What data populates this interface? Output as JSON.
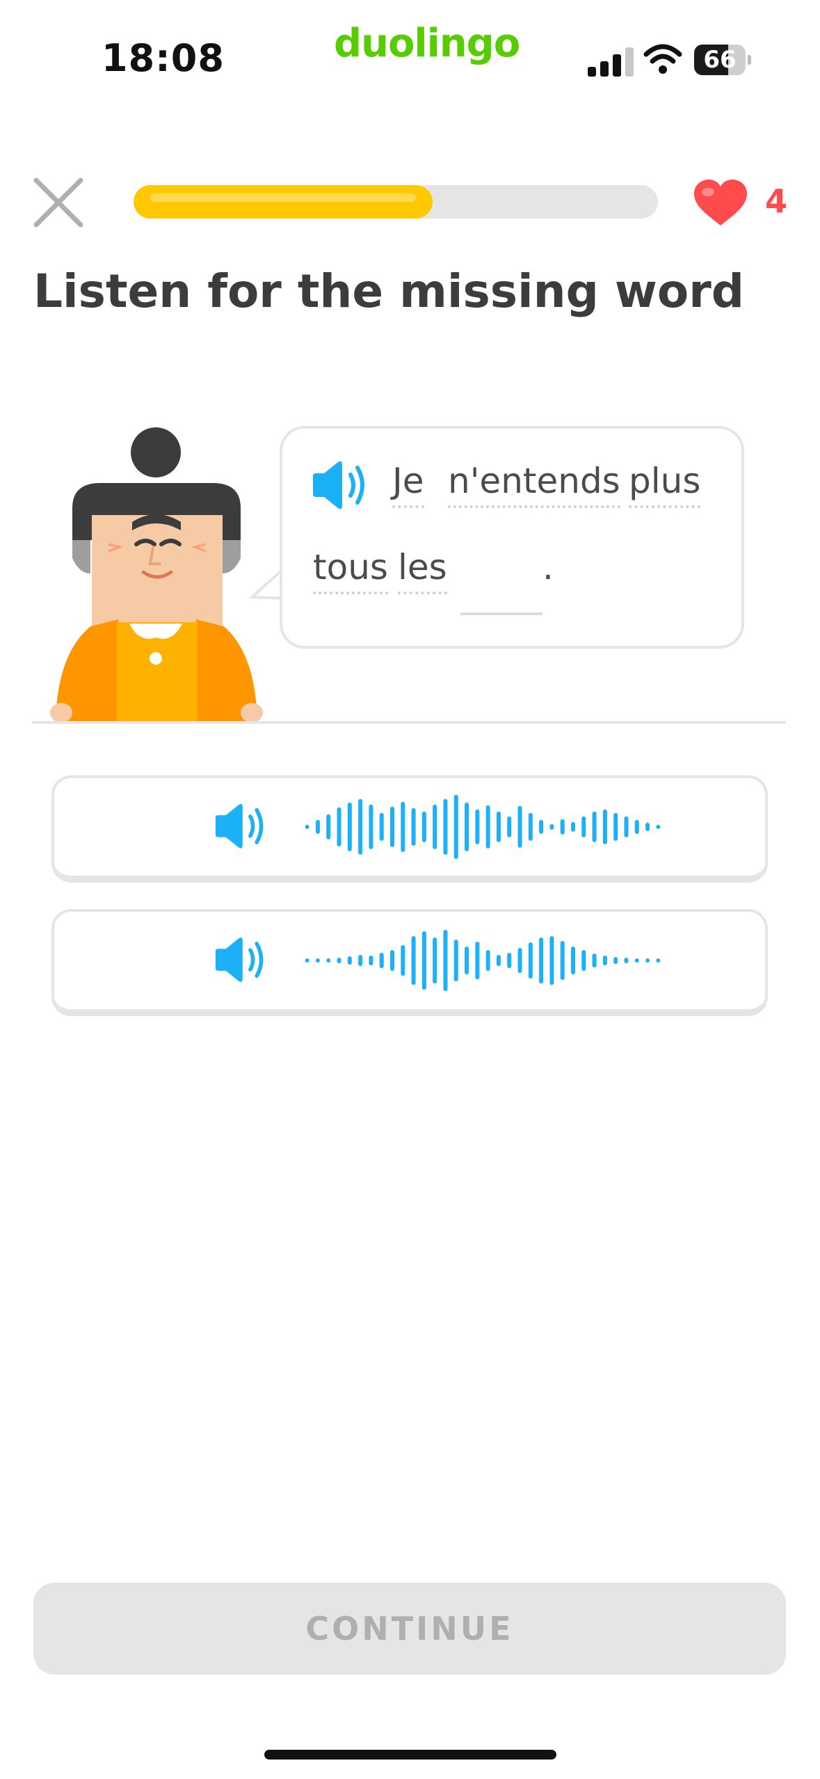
{
  "status_bar": {
    "time": "18:08",
    "brand": "duolingo",
    "battery_level": "66",
    "icons": [
      "signal-icon",
      "wifi-icon",
      "battery-icon"
    ]
  },
  "header": {
    "close_icon": "close-icon",
    "progress_fraction": 0.57,
    "hearts_icon": "heart-icon",
    "hearts_count": "4"
  },
  "exercise": {
    "title": "Listen for the missing word",
    "speaker_icon": "speaker-icon",
    "sentence_words": [
      "Je",
      "n'entends",
      "plus",
      "tous",
      "les"
    ],
    "blank_punctuation": "."
  },
  "options": [
    {
      "icon": "speaker-icon",
      "waveform": "waveform-1"
    },
    {
      "icon": "speaker-icon",
      "waveform": "waveform-2"
    }
  ],
  "footer": {
    "continue_label": "CONTINUE"
  },
  "colors": {
    "brand_green": "#58cc02",
    "progress_yellow": "#ffc800",
    "heart_red": "#ff4b4b",
    "audio_blue": "#1cb0f6",
    "disabled_gray": "#e5e5e5"
  }
}
